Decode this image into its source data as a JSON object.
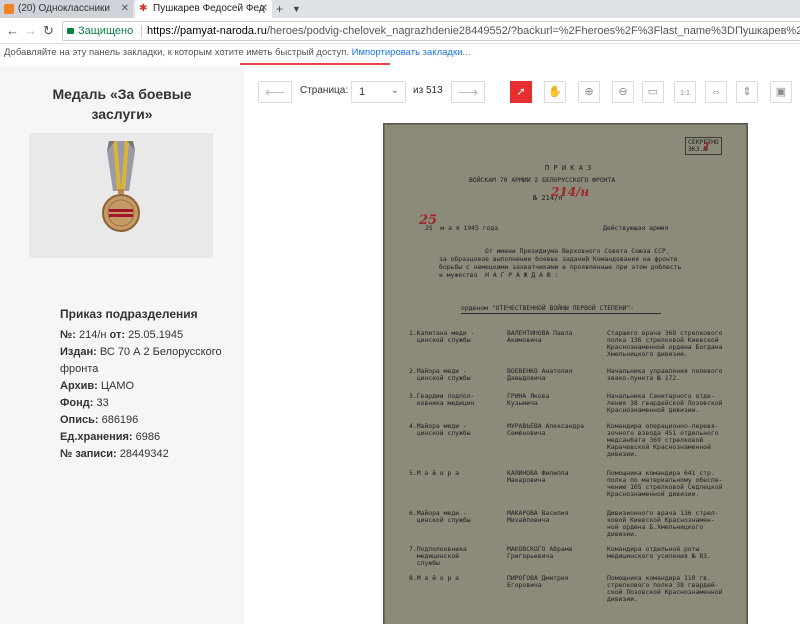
{
  "browser": {
    "tab1": "(20) Одноклассники",
    "tab2": "Пушкарев Федосей Фед",
    "secure_label": "Защищено",
    "url_host": "https://pamyat-naroda.ru",
    "url_path": "/heroes/podvig-chelovek_nagrazhdenie28449552/?backurl=%2Fheroes%2F%3Flast_name%3DПушкарев%26first_name%3",
    "bookmarks_text": "Добавляйте на эту панель закладки, к которым хотите иметь быстрый доступ.",
    "bookmarks_link": "Импортировать закладки..."
  },
  "sidebar": {
    "medal_title": "Медаль «За боевые заслуги»",
    "section_title": "Приказ подразделения",
    "number_label": "№:",
    "number_value": "214/н",
    "from_label": "от:",
    "from_value": "25.05.1945",
    "issued_label": "Издан:",
    "issued_value": "ВС 70 А 2 Белорусского фронта",
    "archive_label": "Архив:",
    "archive_value": "ЦАМО",
    "fond_label": "Фонд:",
    "fond_value": "33",
    "opis_label": "Опись:",
    "opis_value": "686196",
    "unit_label": "Ед.хранения:",
    "unit_value": "6986",
    "record_label": "№ записи:",
    "record_value": "28449342"
  },
  "viewer": {
    "prev": "⟵",
    "next": "⟶",
    "page_label": "Страница:",
    "page_value": "1",
    "of_label": "из 513"
  },
  "document": {
    "stamp": "СЕКРЕТНО\nЭКЗ.№",
    "title": "П Р И К А З",
    "subtitle1": "ВОЙСКАМ 70 АРМИИ 2 БЕЛОРУССКОГО ФРОНТА",
    "number": "№ 214/н",
    "date_left": "25  м а я 1945 года",
    "date_right": "Действующая армия",
    "intro1": "От имени Президиума Верховного Совета Союза ССР,",
    "intro2": "за образцовое выполнение боевых заданий Командования на фронте",
    "intro3": "борьбы с немецкими захватчиками и проявленные при этом доблесть",
    "intro4": "и мужество  Н А Г Р А Ж Д А Ю :",
    "award": "орденом \"ОТЕЧЕСТВЕННОЙ ВОЙНЫ ПЕРВОЙ СТЕПЕНИ\"-",
    "rows": [
      {
        "n": "1.Капитана меди -\n  цинской службы",
        "name": "ВАЛЕНТИНОВА Павла\nАкимовича",
        "desc": "Старшего врача 368 стрелкового\nполка 136 стрелковой Киевской\nКраснознаменной ордена Богдана\nХмельницкого дивизии."
      },
      {
        "n": "2.Майора меди -\n  цинской службы",
        "name": "ВОЕВЕНКО Анатолия\nДавыдовича",
        "desc": "Начальника управления полевого\nэвако-пункта № 172."
      },
      {
        "n": "3.Гвардии подпол-\n  ковника медицин",
        "name": "ГРИНА Якова\nКузьмича",
        "desc": "Начальника Санитарного отде-\nления 38 гвардейской Лозовской\nКраснознаменной дивизии."
      },
      {
        "n": "4.Майора меди -\n  цинской службы",
        "name": "МУРАВЬЕВА Александра\nСемёновича",
        "desc": "Командира операционно-перевя-\nзочного взвода 451 отдельного\nмедсанбата 369 стрелковой\nКарачевской Краснознаменной\nдивизии."
      },
      {
        "n": "5.М а й о р а",
        "name": "КАЛИНОВА Филиппа\nМакаровича",
        "desc": "Помощника командира 641 стр.\nполка по материальному обеспе-\nчению 165 стрелковой Седлецкой\nКраснознаменной дивизии."
      },
      {
        "n": "6.Майора меди -\n  цинской службы",
        "name": "МАКАРОВА Василия\nМихайловича",
        "desc": "Дивизионного врача 136 стрел-\nковой Киевской Краснознамен-\nной ордена Б.Хмельницкого\nдивизии."
      },
      {
        "n": "7.Подполковника\n  медицинской\n  службы",
        "name": "МАКОВСКОГО Абрама\nГригорьевича",
        "desc": "Командира отдельной роты\nмедицинского усиления № 83."
      },
      {
        "n": "8.М а й о р а",
        "name": "ПИРОГОВА Дмитрия\nЕгоровича",
        "desc": "Помощника командира 110 гв.\nстрелкового полка 38 гвардей-\nской Лозовской Краснознаменной\nдивизии."
      }
    ]
  }
}
